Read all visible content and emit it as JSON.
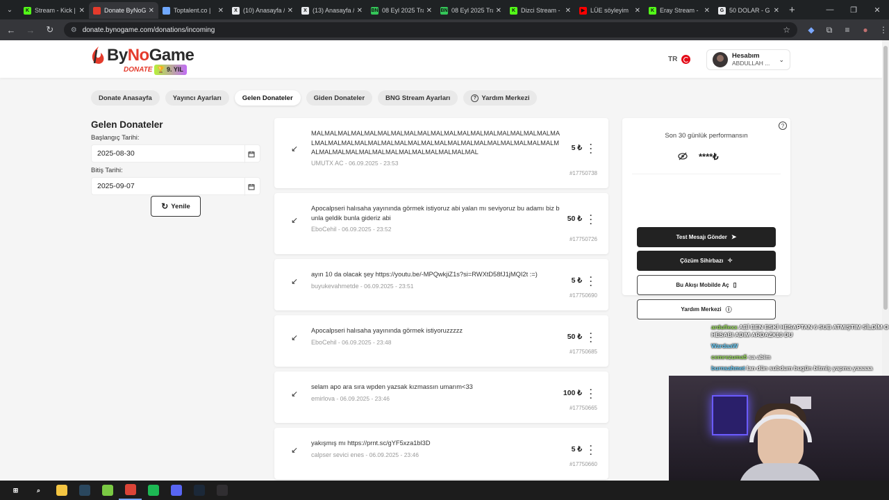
{
  "browser": {
    "tabs": [
      {
        "label": "Stream - Kick |",
        "fav_color": "#53fc18",
        "fav_glyph": "K"
      },
      {
        "label": "Donate ByNoG",
        "fav_color": "#e43b2c",
        "fav_glyph": "",
        "active": true
      },
      {
        "label": "Toptalent.co |",
        "fav_color": "#6fa8ff",
        "fav_glyph": ""
      },
      {
        "label": "(10) Anasayfa /",
        "fav_color": "#e8eaed",
        "fav_glyph": "X"
      },
      {
        "label": "(13) Anasayfa /",
        "fav_color": "#e8eaed",
        "fav_glyph": "X"
      },
      {
        "label": "08 Eyl 2025 Tra",
        "fav_color": "#34c759",
        "fav_glyph": "BN"
      },
      {
        "label": "08 Eyl 2025 Tra",
        "fav_color": "#34c759",
        "fav_glyph": "BN"
      },
      {
        "label": "Dizci Stream -",
        "fav_color": "#53fc18",
        "fav_glyph": "K"
      },
      {
        "label": "LÜE söyleyim",
        "fav_color": "#ff0000",
        "fav_glyph": "▶"
      },
      {
        "label": "Eray Stream -",
        "fav_color": "#53fc18",
        "fav_glyph": "K"
      },
      {
        "label": "50 DOLAR - G",
        "fav_color": "#e8eaed",
        "fav_glyph": "G"
      }
    ],
    "url": "donate.bynogame.com/donations/incoming"
  },
  "header": {
    "brand_a": "By",
    "brand_b": "No",
    "brand_c": "Game",
    "brand_sub": "DONATE",
    "year_badge": "9. YIL",
    "lang": "TR",
    "account_title": "Hesabım",
    "account_name": "ABDULLAH ..."
  },
  "nav": [
    {
      "label": "Donate Anasayfa"
    },
    {
      "label": "Yayıncı Ayarları"
    },
    {
      "label": "Gelen Donateler",
      "active": true
    },
    {
      "label": "Giden Donateler"
    },
    {
      "label": "BNG Stream Ayarları"
    },
    {
      "label": "Yardım Merkezi",
      "icon": "help-circle-icon"
    }
  ],
  "filter": {
    "title": "Gelen Donateler",
    "start_label": "Başlangıç Tarihi:",
    "start_value": "2025-08-30",
    "end_label": "Bitiş Tarihi:",
    "end_value": "2025-09-07",
    "refresh_label": "Yenile"
  },
  "donations": [
    {
      "message": "MALMALMALMALMALMALMALMALMALMALMALMALMALMALMALMALMALMALMALMALMALMALMALMALMALMALMALMALMALMALMALMALMALMALMALMALMALMALMALMALMALMALMALMALMALMALMALMALMALMAL",
      "user": "UMUTX AC",
      "date": "06.09.2025 - 23:53",
      "amount": "5 ₺",
      "id": "#17750738"
    },
    {
      "message": "Apocalpseri halısaha yayınında görmek istiyoruz abi yalan mı seviyoruz bu adamı biz bunla geldik bunla gideriz abi",
      "user": "EboCehil",
      "date": "06.09.2025 - 23:52",
      "amount": "50 ₺",
      "id": "#17750726"
    },
    {
      "message": "ayın 10 da olacak şey https://youtu.be/-MPQwkjiZ1s?si=RWXtD58fJ1jMQI2t :=)",
      "user": "buyukevahmetde",
      "date": "06.09.2025 - 23:51",
      "amount": "5 ₺",
      "id": "#17750690"
    },
    {
      "message": "Apocalpseri halısaha yayınında görmek istiyoruzzzzz",
      "user": "EboCehil",
      "date": "06.09.2025 - 23:48",
      "amount": "50 ₺",
      "id": "#17750685"
    },
    {
      "message": "selam apo ara sıra wpden yazsak kızmassın umarım<33",
      "user": "emirlova",
      "date": "06.09.2025 - 23:46",
      "amount": "100 ₺",
      "id": "#17750665"
    },
    {
      "message": "yakışmış mı https://prnt.sc/gYF5xza1bl3D",
      "user": "calpser sevici enes",
      "date": "06.09.2025 - 23:46",
      "amount": "5 ₺",
      "id": "#17750660"
    }
  ],
  "performance": {
    "title": "Son 30 günlük performansın",
    "value": "****₺",
    "btn_test": "Test Mesajı Gönder",
    "btn_wizard": "Çözüm Sihirbazı",
    "btn_mobile": "Bu Akışı Mobilde Aç",
    "btn_help": "Yardım Merkezi"
  },
  "chat": [
    {
      "user": "arduflexx",
      "text": "ABİ BEN ESKİ HESAPTAN 6 SUB ATMIŞTIM SİLDİM O HESABI ADIM ARDAZX10 DU"
    },
    {
      "user": "WardaaW",
      "text": ""
    },
    {
      "user": "cemrezuma5",
      "text": "sa abim"
    },
    {
      "user": "burnsahmet",
      "text": "lan dün subdum bugün bitmiş yapma yaaaaa"
    }
  ],
  "taskbar": [
    {
      "icon": "windows-start-icon",
      "color": "#1c1c1c",
      "glyph": "⊞"
    },
    {
      "icon": "search-icon",
      "color": "#1c1c1c",
      "glyph": "⌕"
    },
    {
      "icon": "file-explorer-icon",
      "color": "#f4c542",
      "glyph": ""
    },
    {
      "icon": "steam-icon",
      "color": "#2a475e",
      "glyph": ""
    },
    {
      "icon": "notepad-icon",
      "color": "#7ac943",
      "glyph": ""
    },
    {
      "icon": "chrome-icon",
      "color": "#db4437",
      "glyph": "",
      "active": true
    },
    {
      "icon": "spotify-icon",
      "color": "#1db954",
      "glyph": ""
    },
    {
      "icon": "discord-icon",
      "color": "#5865f2",
      "glyph": ""
    },
    {
      "icon": "steam-alt-icon",
      "color": "#1b2838",
      "glyph": ""
    },
    {
      "icon": "obs-icon",
      "color": "#302e31",
      "glyph": ""
    }
  ]
}
